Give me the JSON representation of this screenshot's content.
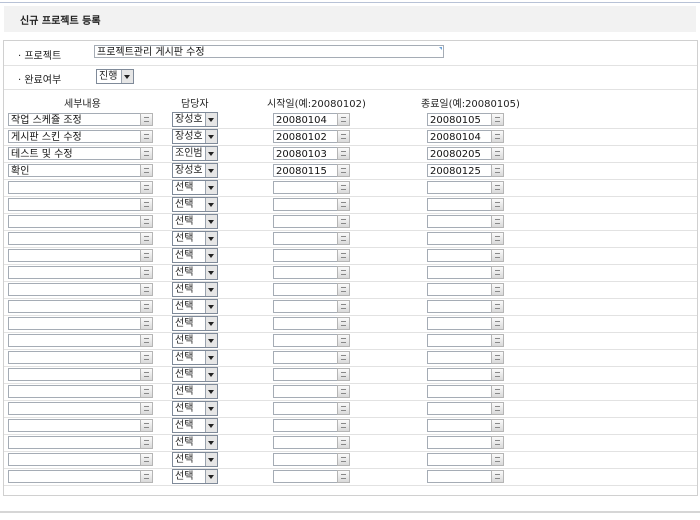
{
  "page": {
    "title": "신규 프로젝트 등록"
  },
  "form": {
    "project_label": "· 프로젝트",
    "project_value": "프로젝트관리 게시판 수정",
    "status_label": "· 완료여부",
    "status_value": "진행"
  },
  "columns": {
    "detail": "세부내용",
    "assignee": "담당자",
    "start": "시작일(예:20080102)",
    "end": "종료일(예:20080105)"
  },
  "rows": [
    {
      "detail": "작업 스케쥴 조정",
      "assignee": "장성호",
      "start": "20080104",
      "end": "20080105"
    },
    {
      "detail": "게시판 스킨 수정",
      "assignee": "장성호",
      "start": "20080102",
      "end": "20080104"
    },
    {
      "detail": "테스트 및 수정",
      "assignee": "조인범",
      "start": "20080103",
      "end": "20080205"
    },
    {
      "detail": "확인",
      "assignee": "장성호",
      "start": "20080115",
      "end": "20080125"
    },
    {
      "detail": "",
      "assignee": "선택",
      "start": "",
      "end": ""
    },
    {
      "detail": "",
      "assignee": "선택",
      "start": "",
      "end": ""
    },
    {
      "detail": "",
      "assignee": "선택",
      "start": "",
      "end": ""
    },
    {
      "detail": "",
      "assignee": "선택",
      "start": "",
      "end": ""
    },
    {
      "detail": "",
      "assignee": "선택",
      "start": "",
      "end": ""
    },
    {
      "detail": "",
      "assignee": "선택",
      "start": "",
      "end": ""
    },
    {
      "detail": "",
      "assignee": "선택",
      "start": "",
      "end": ""
    },
    {
      "detail": "",
      "assignee": "선택",
      "start": "",
      "end": ""
    },
    {
      "detail": "",
      "assignee": "선택",
      "start": "",
      "end": ""
    },
    {
      "detail": "",
      "assignee": "선택",
      "start": "",
      "end": ""
    },
    {
      "detail": "",
      "assignee": "선택",
      "start": "",
      "end": ""
    },
    {
      "detail": "",
      "assignee": "선택",
      "start": "",
      "end": ""
    },
    {
      "detail": "",
      "assignee": "선택",
      "start": "",
      "end": ""
    },
    {
      "detail": "",
      "assignee": "선택",
      "start": "",
      "end": ""
    },
    {
      "detail": "",
      "assignee": "선택",
      "start": "",
      "end": ""
    },
    {
      "detail": "",
      "assignee": "선택",
      "start": "",
      "end": ""
    },
    {
      "detail": "",
      "assignee": "선택",
      "start": "",
      "end": ""
    },
    {
      "detail": "",
      "assignee": "선택",
      "start": "",
      "end": ""
    }
  ]
}
